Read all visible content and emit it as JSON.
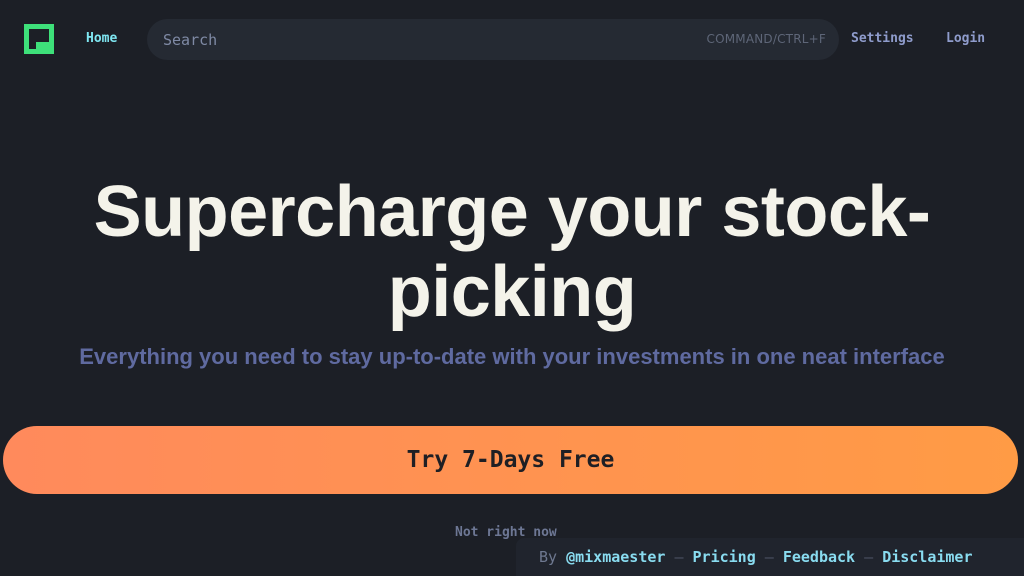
{
  "header": {
    "logo_icon": "app-logo-icon",
    "logo_color": "#3ee07a",
    "home_label": "Home",
    "search_placeholder": "Search",
    "search_shortcut": "COMMAND/CTRL+F",
    "settings_label": "Settings",
    "login_label": "Login"
  },
  "hero": {
    "title": "Supercharge your stock-picking",
    "subtitle": "Everything you need to stay up-to-date with your investments in one neat interface"
  },
  "cta": {
    "label": "Try 7-Days Free",
    "secondary_label": "Not right now"
  },
  "footer": {
    "by_label": "By",
    "author": "@mixmaester",
    "separator": "–",
    "links": [
      "Pricing",
      "Feedback",
      "Disclaimer"
    ]
  },
  "colors": {
    "background": "#1c1f26",
    "accent": "#7fe7f2",
    "cta_start": "#ff8a5c",
    "cta_end": "#ff9b45"
  }
}
